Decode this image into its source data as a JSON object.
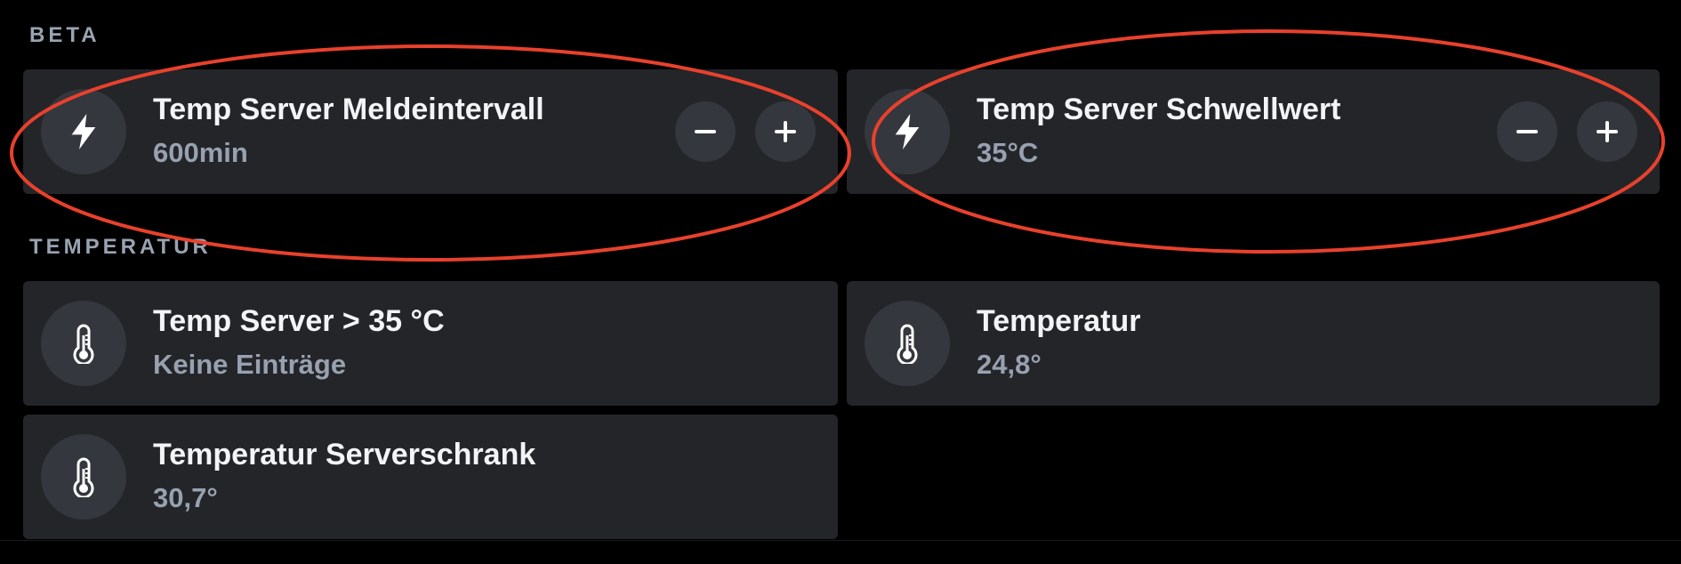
{
  "sections": {
    "beta": {
      "title": "BETA"
    },
    "temperatur": {
      "title": "TEMPERATUR"
    }
  },
  "cards": {
    "meldeintervall": {
      "title": "Temp Server Meldeintervall",
      "value": "600min",
      "icon": "lightning-icon"
    },
    "schwellwert": {
      "title": "Temp Server Schwellwert",
      "value": "35°C",
      "icon": "lightning-icon"
    },
    "temp_alert": {
      "title": "Temp Server > 35 °C",
      "value": "Keine Einträge",
      "icon": "thermometer-icon"
    },
    "temperatur": {
      "title": "Temperatur",
      "value": "24,8°",
      "icon": "thermometer-icon"
    },
    "serverschrank": {
      "title": "Temperatur Serverschrank",
      "value": "30,7°",
      "icon": "thermometer-icon"
    }
  },
  "controls": {
    "decrement_icon": "minus-icon",
    "increment_icon": "plus-icon"
  },
  "colors": {
    "background": "#000000",
    "card": "#232529",
    "icon_circle": "#34373d",
    "annotation": "#e8412c",
    "section_text": "#9aa3b2"
  }
}
